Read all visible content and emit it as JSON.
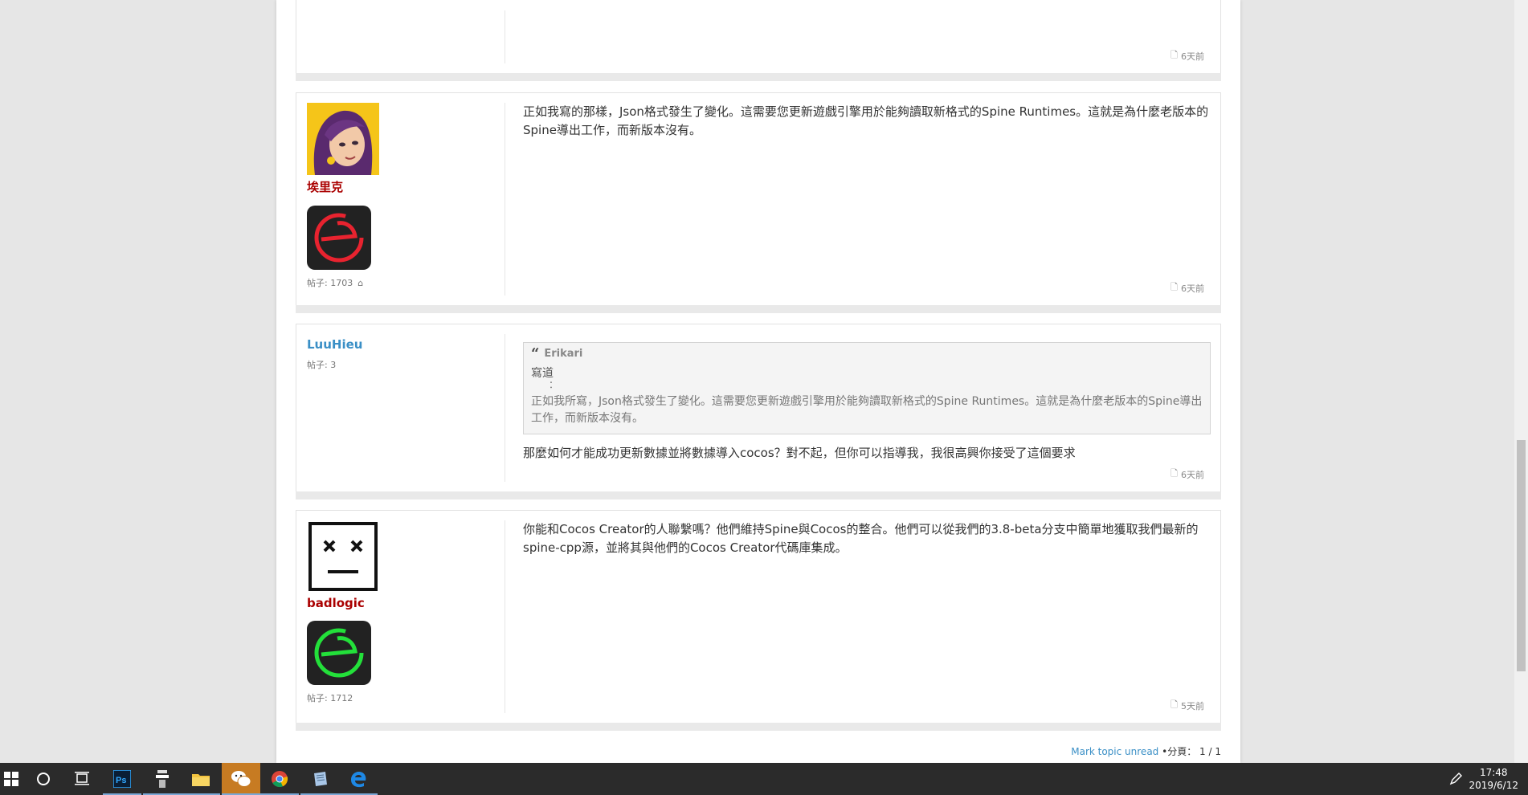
{
  "posts": [
    {
      "timestamp": "6天前"
    },
    {
      "username": "埃里克",
      "post_count": "帖子: 1703",
      "body": "正如我寫的那樣，Json格式發生了變化。這需要您更新遊戲引擎用於能夠讀取新格式的Spine Runtimes。這就是為什麼老版本的Spine導出工作，而新版本沒有。",
      "timestamp": "6天前"
    },
    {
      "username": "LuuHieu",
      "post_count": "帖子: 3",
      "quote": {
        "author": "Erikari",
        "wrote": "寫道",
        "colon": "：",
        "body": "正如我所寫，Json格式發生了變化。這需要您更新遊戲引擎用於能夠讀取新格式的Spine Runtimes。這就是為什麼老版本的Spine導出工作，而新版本沒有。"
      },
      "body": "那麼如何才能成功更新數據並將數據導入cocos？對不起，但你可以指導我，我很高興你接受了這個要求",
      "timestamp": "6天前"
    },
    {
      "username": "badlogic",
      "post_count": "帖子: 1712",
      "body": "你能和Cocos Creator的人聯繫嗎？他們維持Spine與Cocos的整合。他們可以從我們的3.8-beta分支中簡單地獲取我們最新的spine-cpp源，並將其與他們的Cocos Creator代碼庫集成。",
      "timestamp": "5天前"
    }
  ],
  "footer": {
    "mark_unread": "Mark topic unread",
    "separator": " •",
    "pagination_label": "分頁：",
    "pagination_value": "1 / 1"
  },
  "taskbar": {
    "time": "17:48",
    "date": "2019/6/12"
  },
  "colors": {
    "admin_name": "#aa0000",
    "user_name": "#3a8fc6",
    "rank_red": "#e8232f",
    "rank_green": "#23e03a"
  }
}
